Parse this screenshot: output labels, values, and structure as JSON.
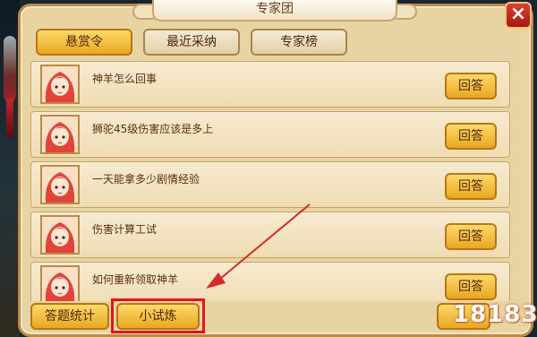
{
  "dialog": {
    "title": "专家团",
    "close_label": "×"
  },
  "tabs": [
    {
      "label": "悬赏令",
      "active": true
    },
    {
      "label": "最近采纳",
      "active": false
    },
    {
      "label": "专家榜",
      "active": false
    }
  ],
  "questions": [
    {
      "text": "神羊怎么回事",
      "button": "回答"
    },
    {
      "text": "狮驼45级伤害应该是多上",
      "button": "回答"
    },
    {
      "text": "一天能拿多少剧情经验",
      "button": "回答"
    },
    {
      "text": "伤害计算工试",
      "button": "回答"
    },
    {
      "text": "如何重新领取神羊",
      "button": "回答"
    }
  ],
  "bottom": {
    "stats_label": "答题统计",
    "trial_label": "小试炼"
  },
  "watermark": "18183",
  "colors": {
    "panel": "#e8d4a2",
    "button_gold": "#e8a820",
    "highlight_red": "#e0161b"
  }
}
